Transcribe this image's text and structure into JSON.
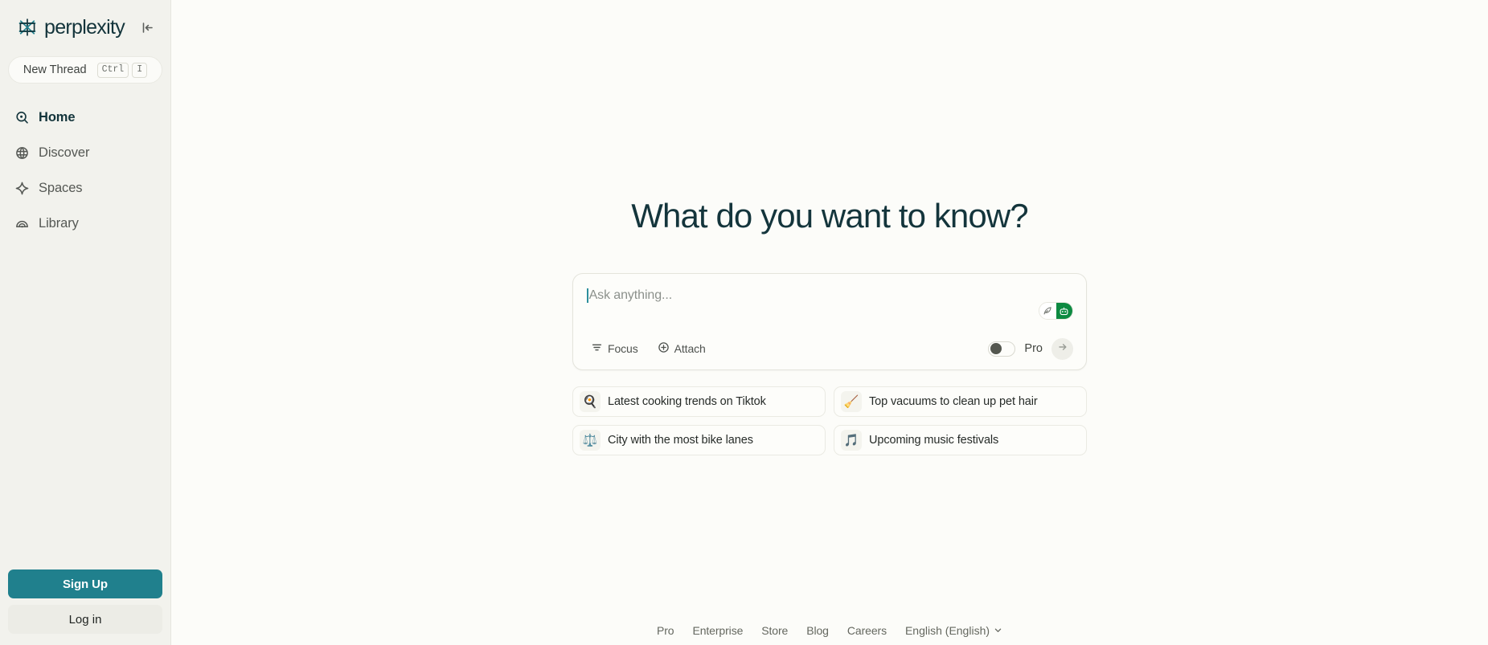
{
  "brand": {
    "name": "perplexity",
    "logo_icon": "perplexity-logo-icon",
    "accent_teal": "#20808D",
    "heading_color": "#14353C"
  },
  "sidebar": {
    "collapse_icon": "collapse-sidebar-icon",
    "new_thread": {
      "label": "New Thread",
      "shortcut_keys": [
        "Ctrl",
        "I"
      ]
    },
    "items": [
      {
        "label": "Home",
        "icon": "search-icon",
        "active": true
      },
      {
        "label": "Discover",
        "icon": "globe-icon",
        "active": false
      },
      {
        "label": "Spaces",
        "icon": "sparkle-icon",
        "active": false
      },
      {
        "label": "Library",
        "icon": "library-arc-icon",
        "active": false
      }
    ],
    "auth": {
      "signup_label": "Sign Up",
      "login_label": "Log in"
    }
  },
  "main": {
    "heading": "What do you want to know?",
    "composer": {
      "placeholder": "Ask anything...",
      "input_value": "",
      "mode_pill": {
        "left_icon": "feather-quill-icon",
        "right_icon": "robot-icon",
        "selected": "robot",
        "active_color": "#0D8A41"
      },
      "focus_label": "Focus",
      "focus_icon": "filter-lines-icon",
      "attach_label": "Attach",
      "attach_icon": "plus-circle-icon",
      "pro_label": "Pro",
      "pro_toggle_on": false,
      "submit_icon": "arrow-right-icon"
    },
    "suggestions": [
      {
        "icon": "frying-pan-icon",
        "glyph": "🍳",
        "label": "Latest cooking trends on Tiktok"
      },
      {
        "icon": "broom-icon",
        "glyph": "🧹",
        "label": "Top vacuums to clean up pet hair"
      },
      {
        "icon": "scales-icon",
        "glyph": "⚖️",
        "label": "City with the most bike lanes"
      },
      {
        "icon": "musical-note-icon",
        "glyph": "🎵",
        "label": "Upcoming music festivals"
      }
    ]
  },
  "footer": {
    "links": [
      "Pro",
      "Enterprise",
      "Store",
      "Blog",
      "Careers"
    ],
    "language": "English (English)",
    "language_chevron_icon": "chevron-down-icon"
  }
}
